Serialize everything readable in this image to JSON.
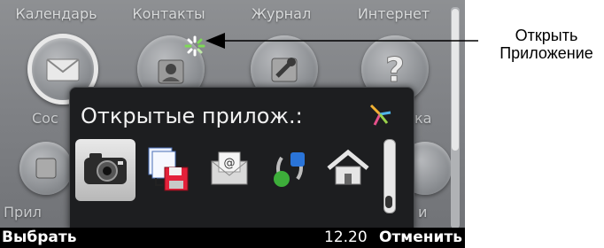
{
  "menu": {
    "top_labels": [
      "Календарь",
      "Контакты",
      "Журнал",
      "Интернет"
    ],
    "partial_left_mid": "Сос",
    "partial_right_mid": "ка",
    "partial_left_bottom": "Прил",
    "partial_right_bottom": "и"
  },
  "popup": {
    "title": "Открытые прилож.:",
    "apps": [
      {
        "icon": "camera-icon"
      },
      {
        "icon": "file-manager-icon"
      },
      {
        "icon": "email-icon"
      },
      {
        "icon": "connectivity-icon"
      },
      {
        "icon": "home-icon"
      }
    ]
  },
  "softkeys": {
    "left": "Выбрать",
    "time": "12.20",
    "right": "Отменить"
  },
  "annotation": {
    "line1": "Открыть",
    "line2": "Приложение"
  },
  "colors": {
    "popup_bg": "#1d1e20",
    "softbar_bg": "#000000",
    "screen_bg": "#808286"
  }
}
